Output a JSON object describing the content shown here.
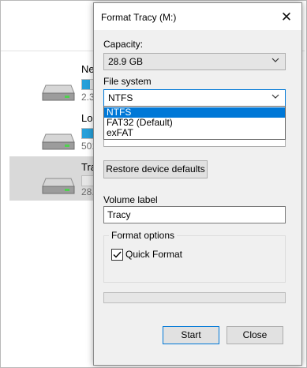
{
  "drives": [
    {
      "name": "Ne",
      "size": "2.3",
      "fill_fraction": 0.5
    },
    {
      "name": "Loc",
      "size": "501",
      "fill_fraction": 0.7
    },
    {
      "name": "Tra",
      "size": "28.",
      "fill_fraction": 0.0
    }
  ],
  "dialog": {
    "title": "Format Tracy (M:)",
    "close_glyph": "✕",
    "capacity_label": "Capacity:",
    "capacity_value": "28.9 GB",
    "filesystem_label": "File system",
    "filesystem_value": "NTFS",
    "filesystem_options": [
      "NTFS",
      "FAT32 (Default)",
      "exFAT"
    ],
    "allocation_value_fragment": "...",
    "restore_button": "Restore device defaults",
    "volume_label": "Volume label",
    "volume_value": "Tracy",
    "format_options_label": "Format options",
    "quick_format_label": "Quick Format",
    "quick_format_checked": true,
    "progress_fraction": 0.0,
    "start_button": "Start",
    "close_button": "Close"
  },
  "colors": {
    "accent": "#0078d7",
    "drive_bar_fill": "#26a0da"
  },
  "icons": {
    "drive": "drive-icon",
    "chevron": "chevron-down-icon",
    "close": "close-icon",
    "checkmark": "checkmark-icon"
  }
}
